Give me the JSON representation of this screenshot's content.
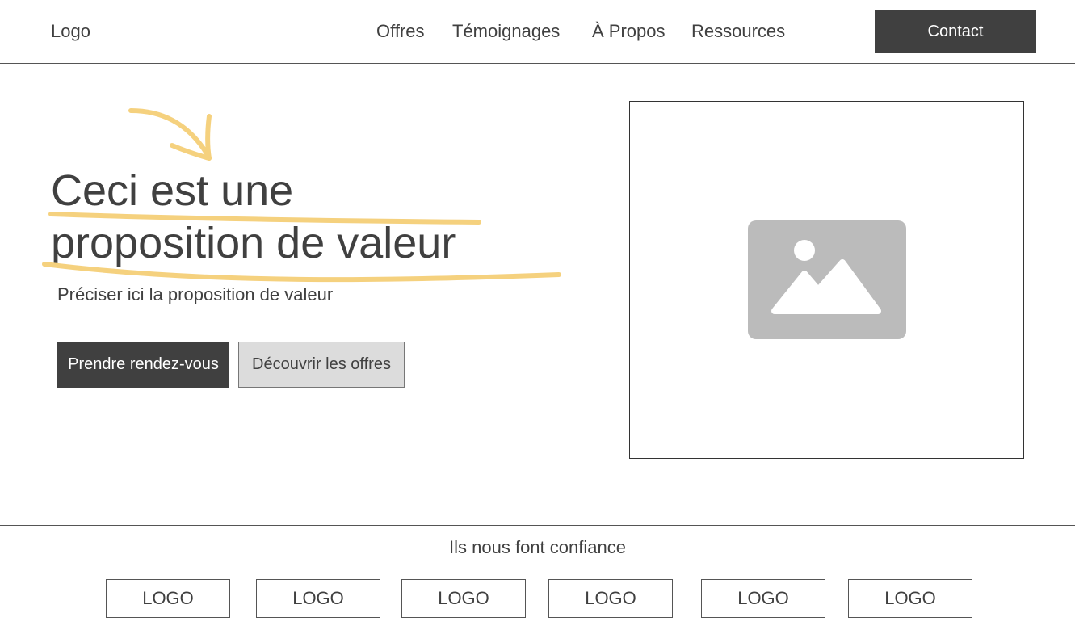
{
  "header": {
    "logo": "Logo",
    "nav": [
      "Offres",
      "Témoignages",
      "À Propos",
      "Ressources"
    ],
    "contact_label": "Contact"
  },
  "hero": {
    "title_line1": "Ceci est une",
    "title_line2": "proposition de valeur",
    "subtitle": "Préciser ici la proposition de valeur",
    "primary_button": "Prendre rendez-vous",
    "secondary_button": "Découvrir les offres"
  },
  "trust": {
    "title": "Ils nous font confiance",
    "logos": [
      "LOGO",
      "LOGO",
      "LOGO",
      "LOGO",
      "LOGO",
      "LOGO"
    ]
  },
  "colors": {
    "dark": "#404040",
    "highlight": "#f5d17e",
    "placeholder": "#bbbbbb",
    "secondary_bg": "#dcdcdc"
  },
  "icons": {
    "hero_arrow": "hand-drawn-arrow-icon",
    "image_placeholder": "image-placeholder-icon"
  }
}
